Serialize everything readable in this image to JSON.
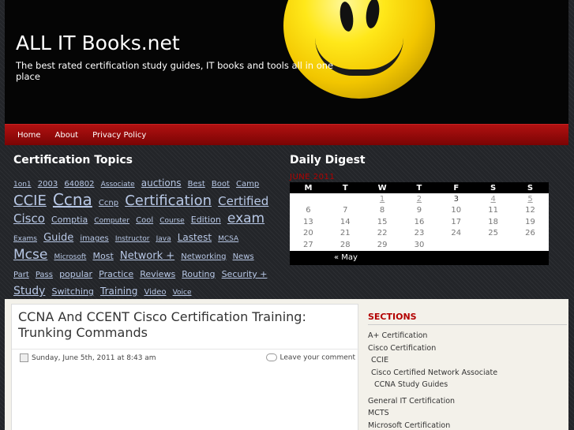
{
  "header": {
    "site_title": "ALL IT Books.net",
    "tagline": "The best rated certification study guides, IT books and tools all in one place"
  },
  "nav": {
    "items": [
      "Home",
      "About",
      "Privacy Policy"
    ]
  },
  "certification_topics": {
    "title": "Certification Topics",
    "tags": [
      {
        "text": "1on1",
        "size": 9
      },
      {
        "text": "2003",
        "size": 10
      },
      {
        "text": "640802",
        "size": 10
      },
      {
        "text": "Associate",
        "size": 9
      },
      {
        "text": "auctions",
        "size": 12
      },
      {
        "text": "Best",
        "size": 10
      },
      {
        "text": "Boot",
        "size": 10
      },
      {
        "text": "Camp",
        "size": 10
      },
      {
        "text": "CCIE",
        "size": 18
      },
      {
        "text": "Ccna",
        "size": 20
      },
      {
        "text": "Ccnp",
        "size": 10
      },
      {
        "text": "Certification",
        "size": 18
      },
      {
        "text": "Certified",
        "size": 15
      },
      {
        "text": "Cisco",
        "size": 15
      },
      {
        "text": "Comptia",
        "size": 11
      },
      {
        "text": "Computer",
        "size": 9
      },
      {
        "text": "Cool",
        "size": 10
      },
      {
        "text": "Course",
        "size": 9
      },
      {
        "text": "Edition",
        "size": 11
      },
      {
        "text": "exam",
        "size": 17
      },
      {
        "text": "Exams",
        "size": 9
      },
      {
        "text": "Guide",
        "size": 13
      },
      {
        "text": "images",
        "size": 10
      },
      {
        "text": "Instructor",
        "size": 9
      },
      {
        "text": "Java",
        "size": 9
      },
      {
        "text": "Lastest",
        "size": 12
      },
      {
        "text": "MCSA",
        "size": 9
      },
      {
        "text": "Mcse",
        "size": 17
      },
      {
        "text": "Microsoft",
        "size": 9
      },
      {
        "text": "Most",
        "size": 11
      },
      {
        "text": "Network +",
        "size": 13
      },
      {
        "text": "Networking",
        "size": 10
      },
      {
        "text": "News",
        "size": 10
      },
      {
        "text": "Part",
        "size": 10
      },
      {
        "text": "Pass",
        "size": 10
      },
      {
        "text": "popular",
        "size": 11
      },
      {
        "text": "Practice",
        "size": 11
      },
      {
        "text": "Reviews",
        "size": 11
      },
      {
        "text": "Routing",
        "size": 11
      },
      {
        "text": "Security +",
        "size": 11
      },
      {
        "text": "Study",
        "size": 14
      },
      {
        "text": "Switching",
        "size": 11
      },
      {
        "text": "Training",
        "size": 12
      },
      {
        "text": "Video",
        "size": 10
      },
      {
        "text": "Voice",
        "size": 9
      }
    ]
  },
  "daily_digest": {
    "title": "Daily Digest",
    "month": "JUNE 2011",
    "weekdays": [
      "M",
      "T",
      "W",
      "T",
      "F",
      "S",
      "S"
    ],
    "weeks": [
      [
        "",
        "",
        "1",
        "2",
        "3",
        "4",
        "5"
      ],
      [
        "6",
        "7",
        "8",
        "9",
        "10",
        "11",
        "12"
      ],
      [
        "13",
        "14",
        "15",
        "16",
        "17",
        "18",
        "19"
      ],
      [
        "20",
        "21",
        "22",
        "23",
        "24",
        "25",
        "26"
      ],
      [
        "27",
        "28",
        "29",
        "30",
        "",
        "",
        ""
      ]
    ],
    "linked_days": [
      "1",
      "2",
      "4",
      "5"
    ],
    "today": "3",
    "prev_link": "« May"
  },
  "post": {
    "title": "CCNA And CCENT Cisco Certification Training: Trunking Commands",
    "date": "Sunday, June 5th, 2011 at 8:43 am",
    "comment_link": "Leave your comment"
  },
  "sections": {
    "title": "SECTIONS",
    "items": [
      {
        "label": "A+ Certification",
        "level": 0
      },
      {
        "label": "Cisco Certification",
        "level": 0
      },
      {
        "label": "CCIE",
        "level": 1
      },
      {
        "label": "Cisco Certified Network Associate",
        "level": 1
      },
      {
        "label": "CCNA Study Guides",
        "level": 2
      },
      {
        "label": "General IT Certification",
        "level": 0
      },
      {
        "label": "MCTS",
        "level": 0
      },
      {
        "label": "Microsoft Certification",
        "level": 0
      }
    ]
  },
  "colors": {
    "nav_red": "#b11111",
    "sections_red": "#b30000",
    "tag_link": "#b8c8e6"
  },
  "icons": [
    "calendar-icon",
    "comment-bubble-icon"
  ]
}
